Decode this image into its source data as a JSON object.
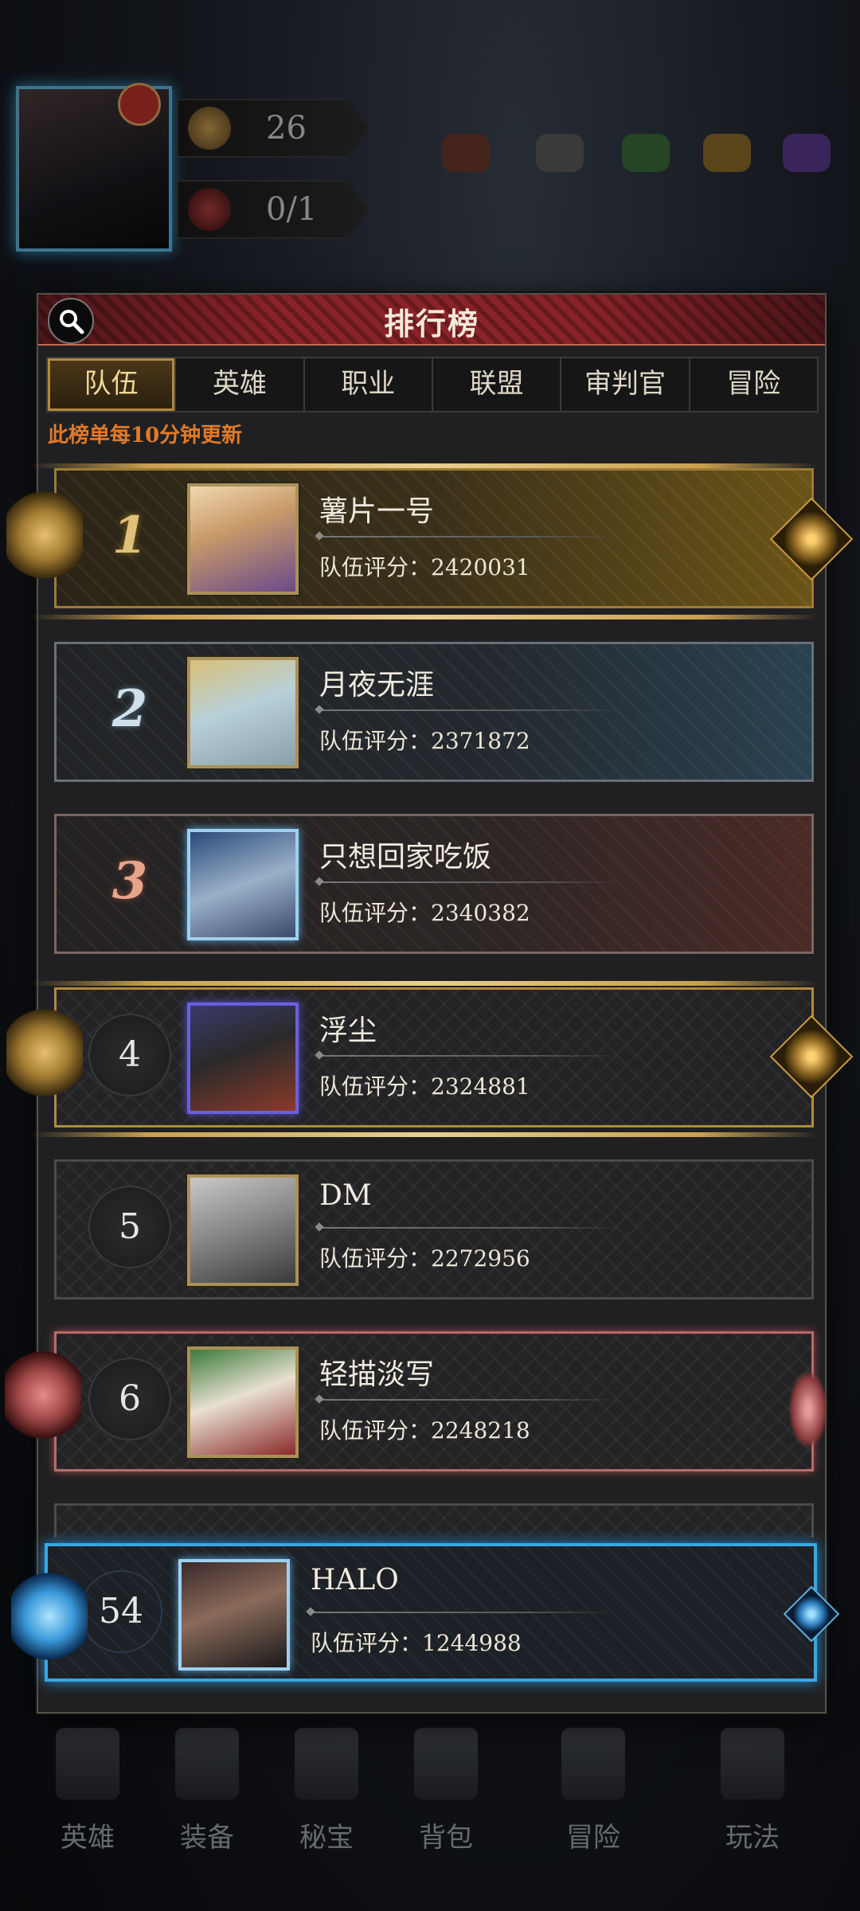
{
  "hud": {
    "level": "26",
    "counter": "0/1",
    "resources": [
      {
        "icon": "meat-icon",
        "value": "",
        "color": "#6a3a2a"
      },
      {
        "icon": "ore-icon",
        "value": "",
        "color": "#5a5a5a"
      },
      {
        "icon": "herb-icon",
        "value": "",
        "color": "#3a6a3a"
      },
      {
        "icon": "gold-ore-icon",
        "value": "",
        "color": "#8a6a2a"
      },
      {
        "icon": "crystal-icon",
        "value": "",
        "color": "#5a3a8a"
      }
    ]
  },
  "panel": {
    "title": "排行榜",
    "notice": "此榜单每10分钟更新"
  },
  "tabs": [
    {
      "label": "队伍",
      "active": true
    },
    {
      "label": "英雄",
      "active": false
    },
    {
      "label": "职业",
      "active": false
    },
    {
      "label": "联盟",
      "active": false
    },
    {
      "label": "审判官",
      "active": false
    },
    {
      "label": "冒险",
      "active": false
    }
  ],
  "rows": [
    {
      "rank": "1",
      "name": "薯片一号",
      "score_label": "队伍评分：",
      "score": "2420031"
    },
    {
      "rank": "2",
      "name": "月夜无涯",
      "score_label": "队伍评分：",
      "score": "2371872"
    },
    {
      "rank": "3",
      "name": "只想回家吃饭",
      "score_label": "队伍评分：",
      "score": "2340382"
    },
    {
      "rank": "4",
      "name": "浮尘",
      "score_label": "队伍评分：",
      "score": "2324881"
    },
    {
      "rank": "5",
      "name": "DM",
      "score_label": "队伍评分：",
      "score": "2272956"
    },
    {
      "rank": "6",
      "name": "轻描淡写",
      "score_label": "队伍评分：",
      "score": "2248218"
    }
  ],
  "self_row": {
    "rank": "54",
    "name": "HALO",
    "score_label": "队伍评分：",
    "score": "1244988"
  },
  "bottom_nav": [
    {
      "label": "英雄",
      "icon": "hero-icon"
    },
    {
      "label": "装备",
      "icon": "equipment-icon"
    },
    {
      "label": "秘宝",
      "icon": "treasure-icon"
    },
    {
      "label": "背包",
      "icon": "bag-icon"
    },
    {
      "label": "冒险",
      "icon": "adventure-icon"
    },
    {
      "label": "玩法",
      "icon": "gameplay-icon"
    }
  ]
}
